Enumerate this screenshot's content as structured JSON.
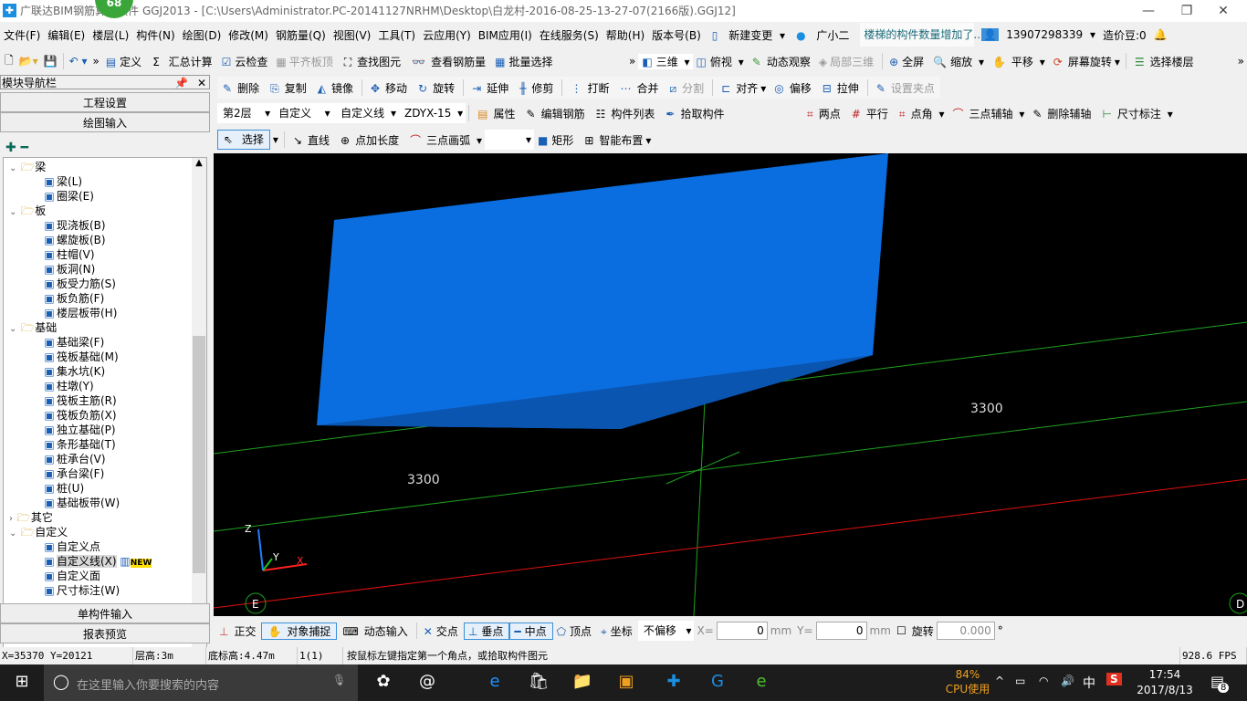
{
  "title": {
    "badge": "68",
    "text": "广联达BIM钢筋算量软件 GGJ2013 - [C:\\Users\\Administrator.PC-20141127NRHM\\Desktop\\白龙村-2016-08-25-13-27-07(2166版).GGJ12]"
  },
  "menu": [
    "文件(F)",
    "编辑(E)",
    "楼层(L)",
    "构件(N)",
    "绘图(D)",
    "修改(M)",
    "钢筋量(Q)",
    "视图(V)",
    "工具(T)",
    "云应用(Y)",
    "BIM应用(I)",
    "在线服务(S)",
    "帮助(H)",
    "版本号(B)",
    "新建变更",
    "广小二"
  ],
  "notice": "楼梯的构件数量增加了..",
  "account": {
    "phone": "13907298339",
    "beans": "造价豆:0"
  },
  "toolbar1": [
    "定义",
    "汇总计算",
    "云检查",
    "平齐板顶",
    "查找图元",
    "查看钢筋量",
    "批量选择"
  ],
  "toolbar1r": [
    "三维",
    "俯视",
    "动态观察",
    "局部三维",
    "全屏",
    "缩放",
    "平移",
    "屏幕旋转",
    "选择楼层"
  ],
  "edit_tools": [
    "删除",
    "复制",
    "镜像",
    "移动",
    "旋转",
    "延伸",
    "修剪",
    "打断",
    "合并",
    "分割",
    "对齐",
    "偏移",
    "拉伸",
    "设置夹点"
  ],
  "selectors": {
    "floor": "第2层",
    "type": "自定义",
    "subtype": "自定义线",
    "name": "ZDYX-15"
  },
  "prop_tools": [
    "属性",
    "编辑钢筋",
    "构件列表",
    "拾取构件"
  ],
  "axis_tools": [
    "两点",
    "平行",
    "点角",
    "三点辅轴",
    "删除辅轴",
    "尺寸标注"
  ],
  "draw_tools": [
    "选择",
    "直线",
    "点加长度",
    "三点画弧",
    "",
    "矩形",
    "智能布置"
  ],
  "nav": {
    "title": "模块导航栏",
    "btn1": "工程设置",
    "btn2": "绘图输入",
    "btn3": "单构件输入",
    "btn4": "报表预览",
    "new": "NEW",
    "tree": [
      {
        "label": "梁",
        "level": 0,
        "folder": true
      },
      {
        "label": "梁(L)",
        "level": 1
      },
      {
        "label": "圈梁(E)",
        "level": 1
      },
      {
        "label": "板",
        "level": 0,
        "folder": true
      },
      {
        "label": "现浇板(B)",
        "level": 1
      },
      {
        "label": "螺旋板(B)",
        "level": 1
      },
      {
        "label": "柱帽(V)",
        "level": 1
      },
      {
        "label": "板洞(N)",
        "level": 1
      },
      {
        "label": "板受力筋(S)",
        "level": 1
      },
      {
        "label": "板负筋(F)",
        "level": 1
      },
      {
        "label": "楼层板带(H)",
        "level": 1
      },
      {
        "label": "基础",
        "level": 0,
        "folder": true
      },
      {
        "label": "基础梁(F)",
        "level": 1
      },
      {
        "label": "筏板基础(M)",
        "level": 1
      },
      {
        "label": "集水坑(K)",
        "level": 1
      },
      {
        "label": "柱墩(Y)",
        "level": 1
      },
      {
        "label": "筏板主筋(R)",
        "level": 1
      },
      {
        "label": "筏板负筋(X)",
        "level": 1
      },
      {
        "label": "独立基础(P)",
        "level": 1
      },
      {
        "label": "条形基础(T)",
        "level": 1
      },
      {
        "label": "桩承台(V)",
        "level": 1
      },
      {
        "label": "承台梁(F)",
        "level": 1
      },
      {
        "label": "桩(U)",
        "level": 1
      },
      {
        "label": "基础板带(W)",
        "level": 1
      },
      {
        "label": "其它",
        "level": 0,
        "folder": true,
        "collapsed": true
      },
      {
        "label": "自定义",
        "level": 0,
        "folder": true
      },
      {
        "label": "自定义点",
        "level": 1
      },
      {
        "label": "自定义线(X)",
        "level": 1,
        "selected": true,
        "new": true
      },
      {
        "label": "自定义面",
        "level": 1
      },
      {
        "label": "尺寸标注(W)",
        "level": 1
      }
    ]
  },
  "canvas": {
    "dim1": "3300",
    "dim2": "3300",
    "axis_e": "E",
    "axis_d": "D",
    "x": "X",
    "y": "Y",
    "z": "Z",
    "shape_color": "#0a6ee0"
  },
  "snap": {
    "tools": [
      "正交",
      "对象捕捉",
      "动态输入",
      "交点",
      "垂点",
      "中点",
      "顶点",
      "坐标"
    ],
    "offset": "不偏移",
    "xl": "X=",
    "xv": "0",
    "yl": "Y=",
    "yv": "0",
    "mm": "mm",
    "rotate": "旋转",
    "rv": "0.000",
    "deg": "°"
  },
  "status": {
    "coords": "X=35370 Y=20121",
    "floor_h": "层高:3m",
    "base_h": "底标高:4.47m",
    "count": "1(1)",
    "hint": "按鼠标左键指定第一个角点，或拾取构件图元",
    "fps": "928.6 FPS"
  },
  "taskbar": {
    "search": "在这里输入你要搜索的内容",
    "cpu": "84%",
    "cpu_label": "CPU使用",
    "time": "17:54",
    "date": "2017/8/13",
    "ime": "中",
    "notif": "8"
  }
}
